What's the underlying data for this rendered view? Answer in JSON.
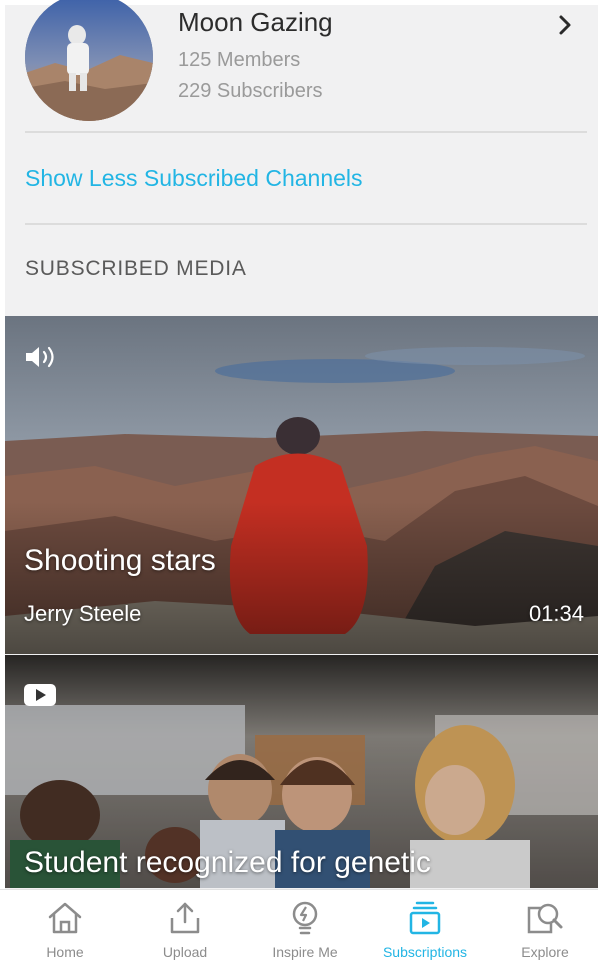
{
  "channel": {
    "title": "Moon Gazing",
    "members": "125 Members",
    "subscribers": "229 Subscribers"
  },
  "show_less_label": "Show Less Subscribed Channels",
  "section_heading": "SUBSCRIBED MEDIA",
  "media": [
    {
      "type_icon": "speaker-icon",
      "title": "Shooting stars",
      "author": "Jerry Steele",
      "duration": "01:34"
    },
    {
      "type_icon": "video-play-icon",
      "title": "Student recognized for genetic"
    }
  ],
  "tabs": [
    {
      "label": "Home",
      "icon": "home-icon"
    },
    {
      "label": "Upload",
      "icon": "upload-icon"
    },
    {
      "label": "Inspire Me",
      "icon": "lightbulb-icon"
    },
    {
      "label": "Subscriptions",
      "icon": "subscriptions-icon",
      "active": true
    },
    {
      "label": "Explore",
      "icon": "explore-icon"
    }
  ],
  "colors": {
    "accent": "#22b5e4",
    "background": "#f1f1f2",
    "text_primary": "#2c2c2c",
    "text_secondary": "#9a9a9a"
  }
}
